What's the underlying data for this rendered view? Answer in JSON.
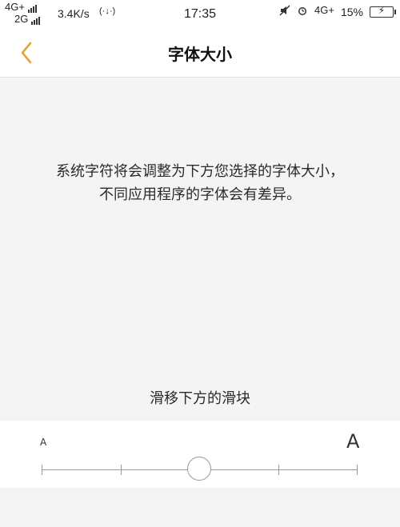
{
  "status_bar": {
    "network_top": "4G+",
    "network_bottom": "2G",
    "speed": "3.4K/s",
    "wifi_symbol": "(·↓·)",
    "time": "17:35",
    "mute_icon": "mute-icon",
    "alarm_icon": "alarm-icon",
    "network_right": "4G+",
    "battery_percent": "15%"
  },
  "nav": {
    "back_icon": "chevron-left-icon",
    "title": "字体大小"
  },
  "content": {
    "description_line1": "系统字符将会调整为下方您选择的字体大小，",
    "description_line2": "不同应用程序的字体会有差异。",
    "slider_hint": "滑移下方的滑块"
  },
  "slider": {
    "min_label": "A",
    "max_label": "A",
    "steps": 5,
    "selected_index": 2
  },
  "colors": {
    "accent": "#E6A23C",
    "background": "#F4F4F4",
    "panel": "#FFFFFF"
  }
}
